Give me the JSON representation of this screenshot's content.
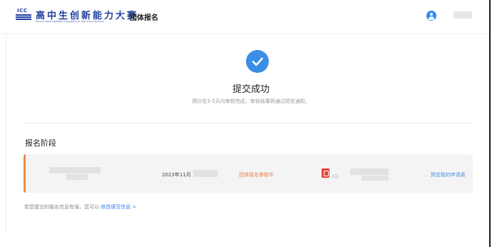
{
  "header": {
    "logo_mark": "ICC",
    "logo_cn": "高中生创新能力大赛",
    "logo_en": "The Innovative Capability Competition for High School Students",
    "nav_title": "团体报名"
  },
  "success": {
    "title": "提交成功",
    "description": "预计在3-5天内审核完成，审核结果将通过短信通知。"
  },
  "stage": {
    "section_title": "报名阶段",
    "row": {
      "date": "2023年11月",
      "status": "团体报名审核中",
      "preview_link": "预览我的申请表"
    }
  },
  "note": {
    "text": "若您提交的报名信息有误，您可以",
    "link": "修改填写信息 >"
  },
  "colors": {
    "accent_blue": "#3a8ee6",
    "status_orange": "#f07c4a",
    "link_blue": "#4a90e2",
    "pdf_red": "#e9403b"
  },
  "icons": {
    "success": "check-circle-icon",
    "user": "user-avatar-icon",
    "file": "pdf-file-icon"
  }
}
